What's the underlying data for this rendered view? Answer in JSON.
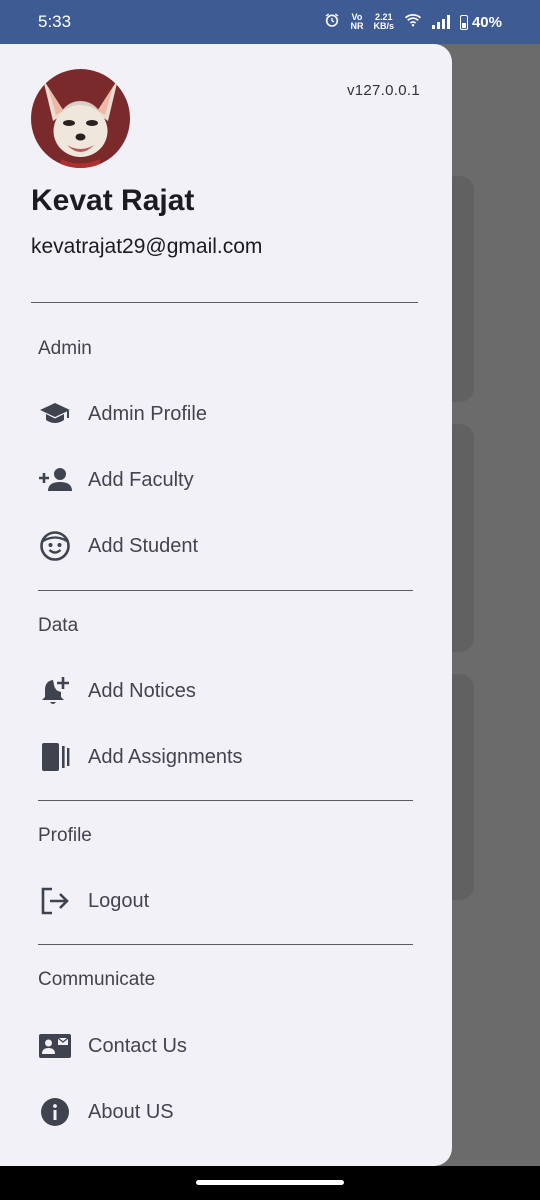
{
  "status_bar": {
    "time": "5:33",
    "network_top": "2.21",
    "network_bottom": "KB/s",
    "volte_top": "Vo",
    "volte_bottom": "NR",
    "battery": "40%"
  },
  "drawer": {
    "version": "v127.0.0.1",
    "user_name": "Kevat Rajat",
    "user_email": "kevatrajat29@gmail.com",
    "sections": [
      {
        "title": "Admin",
        "items": [
          {
            "label": "Admin Profile",
            "icon": "graduation-cap-icon"
          },
          {
            "label": "Add Faculty",
            "icon": "person-add-icon"
          },
          {
            "label": "Add Student",
            "icon": "face-icon"
          }
        ]
      },
      {
        "title": "Data",
        "items": [
          {
            "label": "Add Notices",
            "icon": "notification-add-icon"
          },
          {
            "label": "Add Assignments",
            "icon": "book-icon"
          }
        ]
      },
      {
        "title": "Profile",
        "items": [
          {
            "label": "Logout",
            "icon": "logout-icon"
          }
        ]
      },
      {
        "title": "Communicate",
        "items": [
          {
            "label": "Contact Us",
            "icon": "contact-card-icon"
          },
          {
            "label": "About US",
            "icon": "info-icon"
          }
        ]
      }
    ]
  },
  "colors": {
    "status_bar": "#3f5b93",
    "drawer_bg": "#f3f1f8",
    "scrim": "#6b6b6b",
    "icon": "#3f434f"
  }
}
